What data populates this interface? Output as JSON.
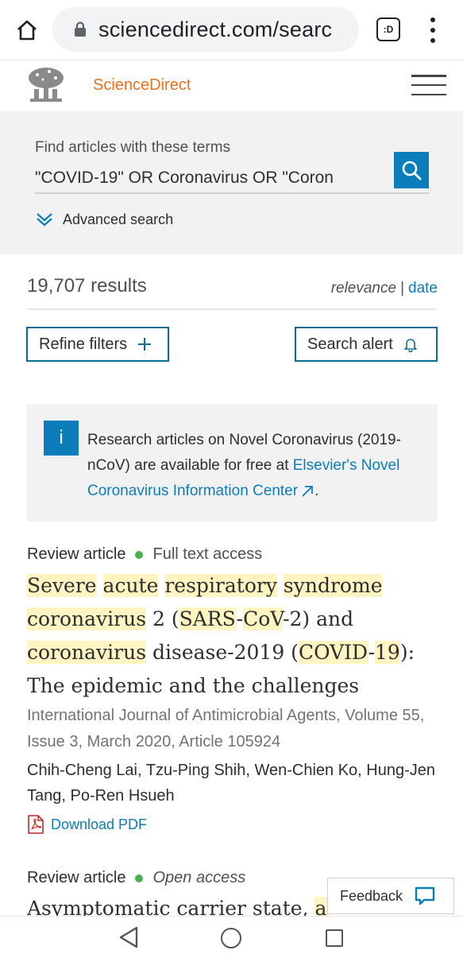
{
  "browser": {
    "url": "sciencedirect.com/searc",
    "tab_label": ":D"
  },
  "header": {
    "brand": "ScienceDirect"
  },
  "search": {
    "label": "Find articles with these terms",
    "value": "\"COVID-19\" OR Coronavirus OR \"Coron",
    "advanced_label": "Advanced search"
  },
  "results": {
    "count": "19,707 results",
    "sort_relevance": "relevance",
    "sort_separator": "|",
    "sort_date": "date",
    "refine_label": "Refine filters",
    "alert_label": "Search alert"
  },
  "info": {
    "icon_letter": "i",
    "text_before": "Research articles on Novel Coronavirus (2019-nCoV) are available for free at ",
    "link_text": "Elsevier's Novel Coronavirus Information Center",
    "text_after": "."
  },
  "articles": [
    {
      "type": "Review article",
      "access": "Full text access",
      "title_parts": {
        "p1": "Severe",
        "p2": "acute",
        "p3": "respiratory",
        "p4": "syndrome",
        "p5": "coronavirus",
        "p6": " 2 (",
        "p7": "SARS",
        "p8": "-",
        "p9": "CoV",
        "p10": "-2) and ",
        "p11": "coronavirus",
        "p12": " disease-2019 (",
        "p13": "COVID",
        "p14": "-",
        "p15": "19",
        "p16": "): The epidemic and the challenges"
      },
      "source": "International Journal of Antimicrobial Agents, Volume 55, Issue 3, March 2020, Article 105924",
      "authors": "Chih-Cheng Lai, Tzu-Ping Shih, Wen-Chien Ko, Hung-Jen Tang, Po-Ren Hsueh",
      "download_label": "Download PDF"
    },
    {
      "type": "Review article",
      "access": "Open access",
      "title_plain": "Asymptomatic carrier state, ",
      "title_hl": "acu"
    }
  ],
  "feedback": {
    "label": "Feedback"
  },
  "colors": {
    "accent": "#0c7dbb",
    "brand_orange": "#e9711c",
    "highlight": "#fff5c2",
    "access_dot": "#4caf50"
  }
}
